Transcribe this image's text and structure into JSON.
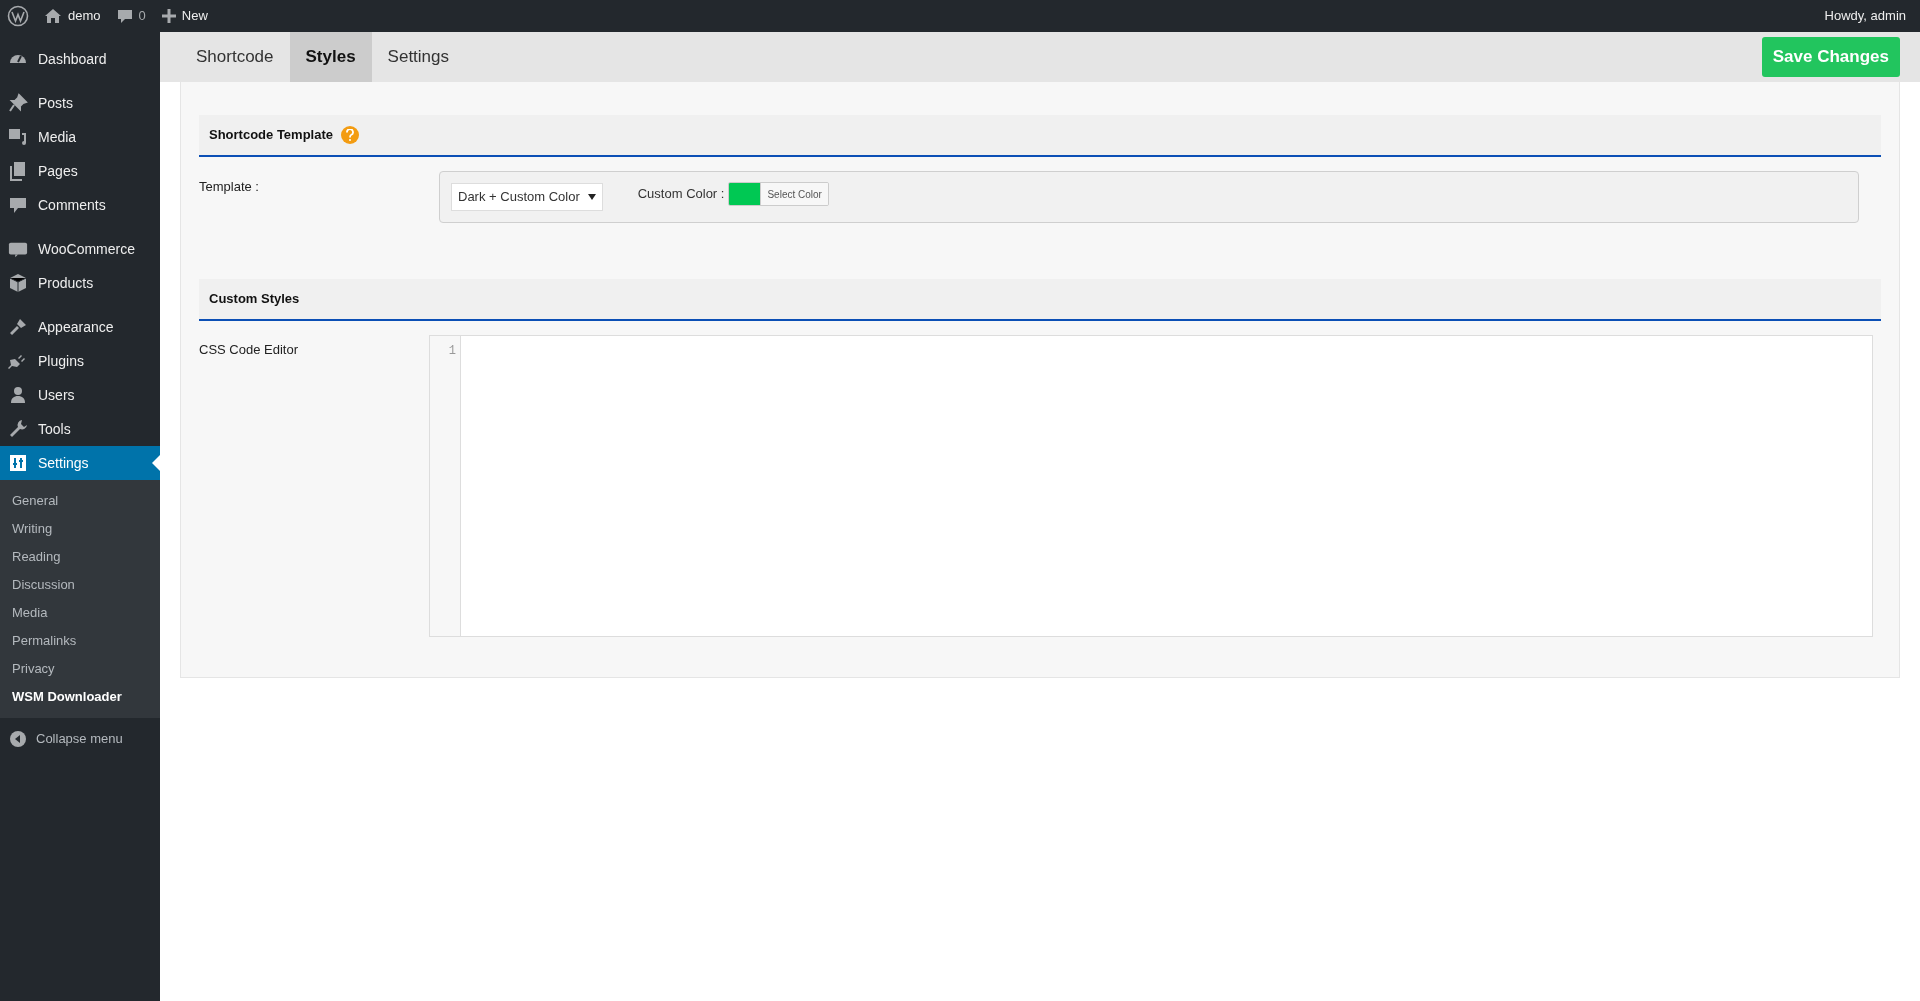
{
  "top_bar": {
    "site": "demo",
    "comments_count": "0",
    "new_label": "New",
    "greeting": "Howdy, admin"
  },
  "sidebar": {
    "groups": [
      [
        {
          "label": "Dashboard",
          "selected": false
        }
      ],
      [
        {
          "label": "Posts",
          "selected": false
        },
        {
          "label": "Media",
          "selected": false
        },
        {
          "label": "Pages",
          "selected": false
        },
        {
          "label": "Comments",
          "selected": false
        }
      ],
      [
        {
          "label": "WooCommerce",
          "selected": false
        },
        {
          "label": "Products",
          "selected": false
        }
      ],
      [
        {
          "label": "Appearance",
          "selected": false
        },
        {
          "label": "Plugins",
          "selected": false
        },
        {
          "label": "Users",
          "selected": false
        },
        {
          "label": "Tools",
          "selected": false
        },
        {
          "label": "Settings",
          "selected": true,
          "children": [
            {
              "label": "General",
              "selected": false
            },
            {
              "label": "Writing",
              "selected": false
            },
            {
              "label": "Reading",
              "selected": false
            },
            {
              "label": "Discussion",
              "selected": false
            },
            {
              "label": "Media",
              "selected": false
            },
            {
              "label": "Permalinks",
              "selected": false
            },
            {
              "label": "Privacy",
              "selected": false
            },
            {
              "label": "WSM Downloader",
              "selected": true
            }
          ]
        }
      ]
    ],
    "collapse_label": "Collapse menu"
  },
  "tabs": [
    {
      "label": "Shortcode",
      "selected": false
    },
    {
      "label": "Styles",
      "selected": true
    },
    {
      "label": "Settings",
      "selected": false
    }
  ],
  "save_button": "Save Changes",
  "sections": [
    {
      "title": "Shortcode Template",
      "help": true,
      "label": "Template :",
      "template_value": "Dark + Custom Color",
      "color_label": "Custom Color :",
      "color": "#00c853",
      "color_button": "Select Color"
    },
    {
      "title": "Custom Styles",
      "help": false,
      "label": "CSS Code Editor",
      "line_numbers": [
        "1"
      ]
    }
  ]
}
